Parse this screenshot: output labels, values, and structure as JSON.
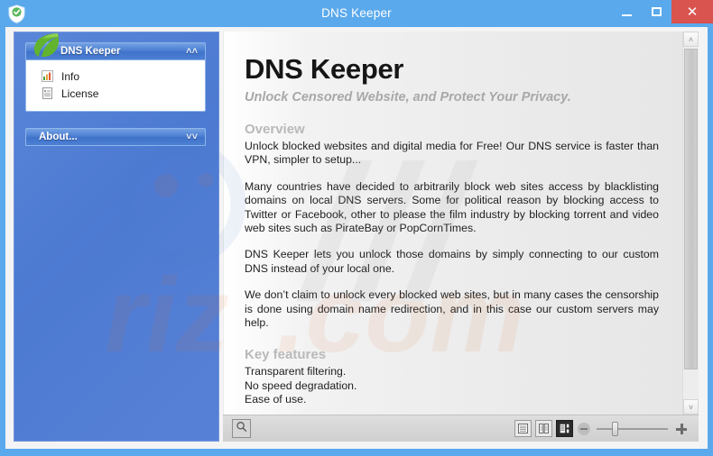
{
  "window": {
    "title": "DNS Keeper",
    "app_icon": "shield-check-icon",
    "minimize_label": "",
    "maximize_label": "",
    "close_label": "✕"
  },
  "sidebar": {
    "panels": [
      {
        "title": "DNS Keeper",
        "icon": "leaf-icon",
        "expanded": true,
        "collapse_chevron": "˄˄",
        "items": [
          {
            "label": "Info",
            "icon": "bar-chart-icon"
          },
          {
            "label": "License",
            "icon": "document-list-icon"
          }
        ]
      },
      {
        "title": "About...",
        "expanded": false,
        "expand_chevron": "˅˅"
      }
    ]
  },
  "content": {
    "title": "DNS Keeper",
    "subtitle": "Unlock Censored Website, and Protect Your Privacy.",
    "sections": [
      {
        "heading": "Overview",
        "paragraphs": [
          "Unlock blocked websites and digital media for Free! Our DNS service is faster than VPN, simpler to setup...",
          "Many countries have decided to arbitrarily block web sites access by blacklisting domains on local DNS servers. Some for political reason by blocking access to Twitter or Facebook, other to please the film industry by blocking torrent and video web sites such as PirateBay or PopCornTimes.",
          "DNS Keeper lets you unlock those domains by simply connecting to our custom DNS instead of your local one.",
          "We don’t claim to unlock every blocked web sites, but in many cases the censorship is done using domain name redirection, and in this case our custom servers may help."
        ]
      },
      {
        "heading": "Key features",
        "features": [
          "Transparent filtering.",
          "No speed degradation.",
          "Ease of use."
        ]
      }
    ]
  },
  "scrollbar": {
    "up_arrow": "˄",
    "down_arrow": "˅"
  },
  "bottombar": {
    "search_icon": "magnifier-icon",
    "view_modes": [
      {
        "name": "single-page-view",
        "active": false
      },
      {
        "name": "two-page-view",
        "active": false
      },
      {
        "name": "page-with-sidebar-view",
        "active": true
      }
    ],
    "zoom_out_icon": "minus-icon",
    "zoom_in_icon": "plus-icon",
    "zoom_value": 30
  },
  "colors": {
    "titlebar": "#5aa9ec",
    "close_button": "#d9534f",
    "sidebar": "#4d7ad2",
    "panel_header": "#4a7cd0",
    "heading_gray": "#b9b9b9",
    "leaf_green": "#56ab2f"
  }
}
